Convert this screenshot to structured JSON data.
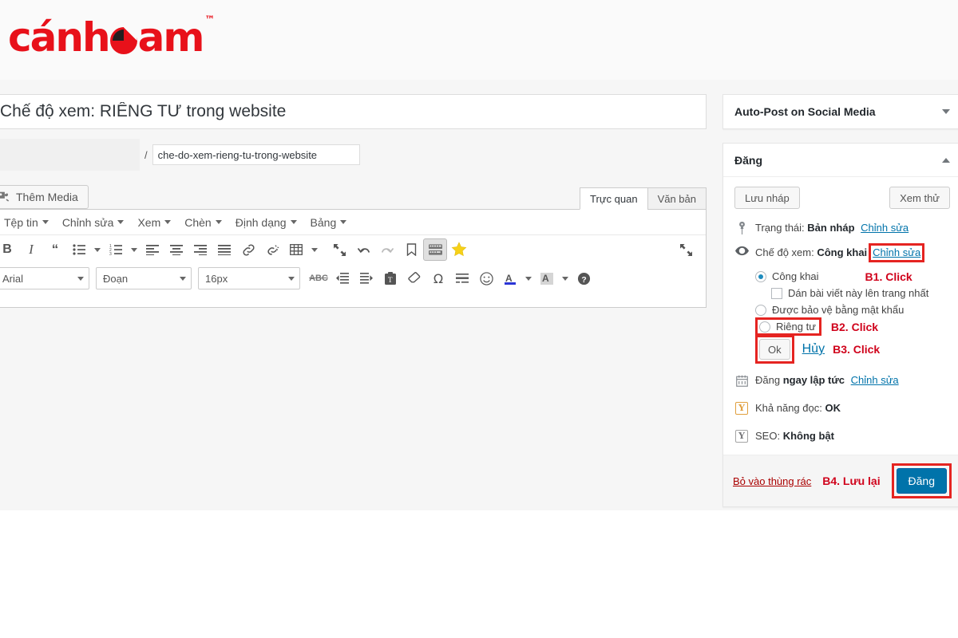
{
  "brand": {
    "logo_text": "cánheam",
    "trademark": "™",
    "color": "#e8111a"
  },
  "editor": {
    "title_value": "Chế độ xem: RIÊNG TƯ trong website",
    "permalink_separator": "/",
    "slug_value": "che-do-xem-rieng-tu-trong-website",
    "add_media_label": "Thêm Media",
    "tabs": [
      {
        "label": "Trực quan",
        "active": true
      },
      {
        "label": "Văn bản",
        "active": false
      }
    ],
    "menubar": [
      {
        "label": "Tệp tin"
      },
      {
        "label": "Chỉnh sửa"
      },
      {
        "label": "Xem"
      },
      {
        "label": "Chèn"
      },
      {
        "label": "Định dạng"
      },
      {
        "label": "Bảng"
      }
    ],
    "toolbar_row1": [
      "bold-icon",
      "italic-icon",
      "blockquote-icon",
      "bullet-list-icon",
      "numbered-list-icon",
      "align-left-icon",
      "align-center-icon",
      "align-right-icon",
      "align-justify-icon",
      "link-icon",
      "unlink-icon",
      "table-icon",
      "fullscreen-icon",
      "undo-icon",
      "redo-icon",
      "bookmark-icon",
      "toolbar-toggle-icon",
      "star-icon"
    ],
    "toolbar_row2": {
      "font_family": "Arial",
      "paragraph_format": "Đoạn",
      "font_size": "16px",
      "buttons": [
        "strikethrough-icon",
        "outdent-icon",
        "indent-icon",
        "paste-as-text-icon",
        "clear-formatting-icon",
        "special-character-icon",
        "horizontal-rule-icon",
        "emoji-icon",
        "text-color-icon",
        "highlight-color-icon",
        "help-icon"
      ]
    }
  },
  "sidebar": {
    "social_panel": {
      "title": "Auto-Post on Social Media",
      "collapsed": true
    },
    "publish_panel": {
      "title": "Đăng",
      "collapsed": false,
      "save_draft_label": "Lưu nháp",
      "preview_label": "Xem thử",
      "status_label": "Trạng thái:",
      "status_value": "Bản nháp",
      "status_edit_link": "Chỉnh sửa",
      "visibility_label": "Chế độ xem:",
      "visibility_value": "Công khai",
      "visibility_edit_link": "Chỉnh sửa",
      "visibility_options": [
        {
          "label": "Công khai",
          "selected": true
        },
        {
          "label": "Được bảo vệ bằng mật khẩu",
          "selected": false
        },
        {
          "label": "Riêng tư",
          "selected": false
        }
      ],
      "sticky_checkbox_label": "Dán bài viết này lên trang nhất",
      "ok_label": "Ok",
      "cancel_label": "Hủy",
      "schedule_label": "Đăng",
      "schedule_value": "ngay lập tức",
      "schedule_edit_link": "Chỉnh sửa",
      "readability_label": "Khả năng đọc:",
      "readability_value": "OK",
      "seo_label": "SEO:",
      "seo_value": "Không bật",
      "trash_label": "Bỏ vào thùng rác",
      "publish_label": "Đăng"
    }
  },
  "annotations": {
    "b1": "B1. Click",
    "b2": "B2. Click",
    "b3": "B3. Click",
    "b4": "B4. Lưu lại",
    "highlight_color": "#e52421",
    "note_color": "#d0021b"
  }
}
